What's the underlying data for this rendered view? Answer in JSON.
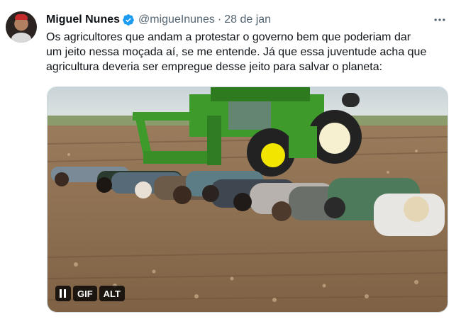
{
  "tweet": {
    "author_name": "Miguel Nunes",
    "handle": "@migueInunes",
    "separator": "·",
    "date": "28 de jan",
    "more_icon": "ellipsis-icon",
    "verified_icon": "verified-badge-icon",
    "verified_color": "#1d9bf0",
    "text": "Os agricultores que andam a protestar o governo bem que poderiam dar\num jeito nessa moçada aí, se me entende. Já que essa juventude acha que\nagricultura deveria ser empregue desse jeito para salvar o planeta:"
  },
  "media": {
    "type": "gif",
    "pause_icon": "pause-icon",
    "gif_label": "GIF",
    "alt_label": "ALT"
  },
  "colors": {
    "text_primary": "#0f1419",
    "text_secondary": "#536471",
    "tractor_green": "#3f9a2c",
    "tractor_yellow": "#f2e600"
  }
}
